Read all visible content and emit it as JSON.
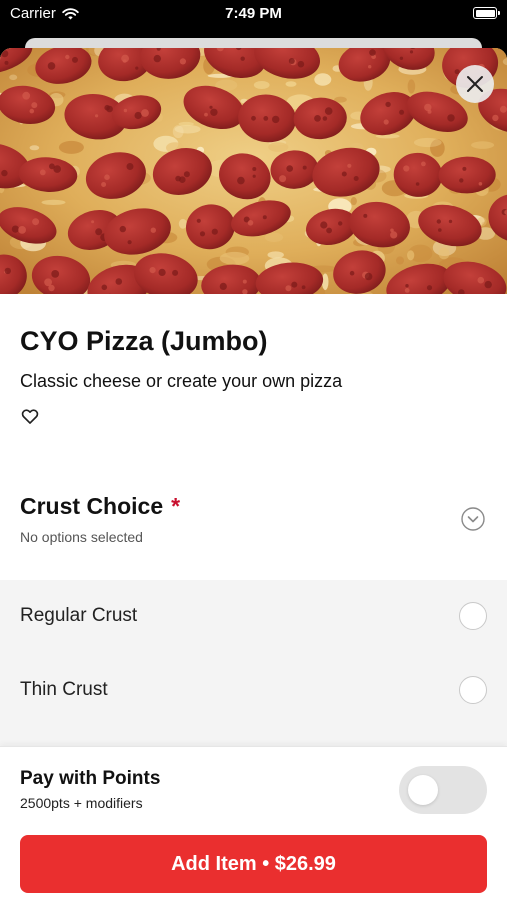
{
  "status_bar": {
    "carrier": "Carrier",
    "time": "7:49 PM"
  },
  "item": {
    "title": "CYO Pizza (Jumbo)",
    "description": "Classic cheese or create your own pizza"
  },
  "modifier_group": {
    "title": "Crust Choice",
    "required_mark": "*",
    "subtitle": "No options selected",
    "options": [
      {
        "label": "Regular Crust",
        "selected": false
      },
      {
        "label": "Thin Crust",
        "selected": false
      }
    ]
  },
  "footer": {
    "points_title": "Pay with Points",
    "points_subtitle": "2500pts + modifiers",
    "points_toggle_on": false,
    "add_button_label": "Add Item • $26.99"
  },
  "icons": {
    "close": "close-icon",
    "favorite": "heart-outline-icon",
    "expand": "chevron-down-circle-icon",
    "wifi": "wifi-icon",
    "battery": "battery-icon"
  },
  "colors": {
    "accent": "#ea2f2f",
    "required": "#c8102e",
    "options_background": "#f4f4f4",
    "toggle_off": "#e3e3e3"
  }
}
